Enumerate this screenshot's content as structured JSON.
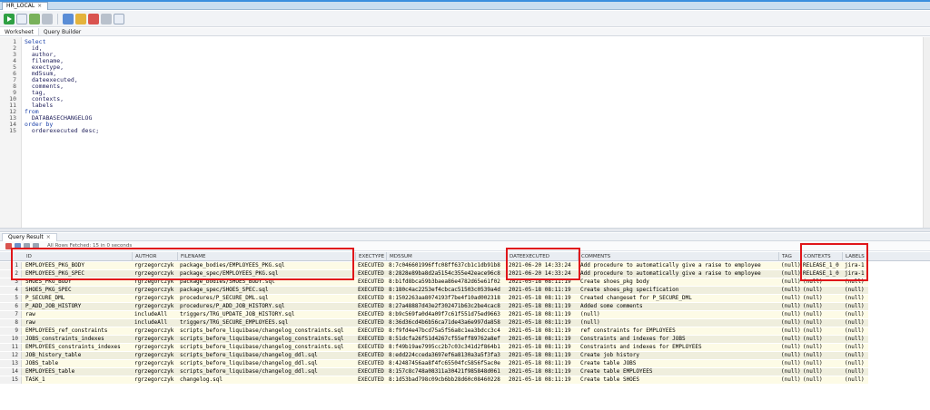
{
  "connection_tab": {
    "label": "HR_LOCAL"
  },
  "subtabs": [
    {
      "label": "Worksheet"
    },
    {
      "label": "Query Builder"
    }
  ],
  "editor": {
    "lines": [
      {
        "n": "1",
        "text": "Select"
      },
      {
        "n": "2",
        "text": "  id,"
      },
      {
        "n": "3",
        "text": "  author,"
      },
      {
        "n": "4",
        "text": "  filename,"
      },
      {
        "n": "5",
        "text": "  exectype,"
      },
      {
        "n": "6",
        "text": "  md5sum,"
      },
      {
        "n": "7",
        "text": "  dateexecuted,"
      },
      {
        "n": "8",
        "text": "  comments,"
      },
      {
        "n": "9",
        "text": "  tag,"
      },
      {
        "n": "10",
        "text": "  contexts,"
      },
      {
        "n": "11",
        "text": "  labels"
      },
      {
        "n": "12",
        "text": "from"
      },
      {
        "n": "13",
        "text": "  DATABASECHANGELOG"
      },
      {
        "n": "14",
        "text": "order by"
      },
      {
        "n": "15",
        "text": "  orderexecuted desc;"
      }
    ]
  },
  "results": {
    "tab_label": "Query Result",
    "fetch_info": "All Rows Fetched: 15 in 0 seconds",
    "columns": [
      "ID",
      "AUTHOR",
      "FILENAME",
      "EXECTYPE",
      "MD5SUM",
      "DATEEXECUTED",
      "COMMENTS",
      "TAG",
      "CONTEXTS",
      "LABELS"
    ],
    "rows": [
      [
        "1",
        "EMPLOYEES_PKG_BODY",
        "rgrzegorczyk",
        "package_bodies/EMPLOYEES_PKG.sql",
        "EXECUTED",
        "8:7c046601996ffc08ff637cb1c1db91b8",
        "2021-06-20 14:33:24",
        "Add procedure to automatically give a raise to employee",
        "(null)",
        "RELEASE_1_0",
        "jira-1"
      ],
      [
        "2",
        "EMPLOYEES_PKG_SPEC",
        "rgrzegorczyk",
        "package_spec/EMPLOYEES_PKG.sql",
        "EXECUTED",
        "8:2828e89ba8d2a5154c355e42eace96c8",
        "2021-06-20 14:33:24",
        "Add procedure to automatically give a raise to employee",
        "(null)",
        "RELEASE_1_0",
        "jira-1"
      ],
      [
        "3",
        "SHOES_PKG_BODY",
        "rgrzegorczyk",
        "package_bodies/SHOES_BODY.sql",
        "EXECUTED",
        "8:b1fd8bca59b3baea86e4782d65e61f02",
        "2021-05-18 08:11:19",
        "Create shoes_pkg body",
        "(null)",
        "(null)",
        "(null)"
      ],
      [
        "4",
        "SHOES_PKG_SPEC",
        "rgrzegorczyk",
        "package_spec/SHOES_SPEC.sql",
        "EXECUTED",
        "8:180c4ac2253ef4cbcac51503c0539a4d",
        "2021-05-18 08:11:19",
        "Create shoes_pkg specification",
        "(null)",
        "(null)",
        "(null)"
      ],
      [
        "5",
        "P_SECURE_DML",
        "rgrzegorczyk",
        "procedures/P_SECURE_DML.sql",
        "EXECUTED",
        "8:1502263aa8074193f7be4f10ad002318",
        "2021-05-18 08:11:19",
        "Created changeset for P_SECURE_DML",
        "(null)",
        "(null)",
        "(null)"
      ],
      [
        "6",
        "P_ADD_JOB_HISTORY",
        "rgrzegorczyk",
        "procedures/P_ADD_JOB_HISTORY.sql",
        "EXECUTED",
        "8:27a48887d43e2f302471b63c2be4cac8",
        "2021-05-18 08:11:19",
        "Added some comments",
        "(null)",
        "(null)",
        "(null)"
      ],
      [
        "7",
        "raw",
        "includeAll",
        "triggers/TRG_UPDATE_JOB_HISTORY.sql",
        "EXECUTED",
        "8:b9c569fa0d4a09f7c61f551d75ed9663",
        "2021-05-18 08:11:19",
        "(null)",
        "(null)",
        "(null)",
        "(null)"
      ],
      [
        "8",
        "raw",
        "includeAll",
        "triggers/TRG_SECURE_EMPLOYEES.sql",
        "EXECUTED",
        "8:36d36cd4b6b56ca71de43a6e997da858",
        "2021-05-18 08:11:19",
        "(null)",
        "(null)",
        "(null)",
        "(null)"
      ],
      [
        "9",
        "EMPLOYEES_ref_constraints",
        "rgrzegorczyk",
        "scripts_before_liquibase/changelog_constraints.sql",
        "EXECUTED",
        "8:f9fd4e47bcd75a5f56a8c1ea3bdcc3c4",
        "2021-05-18 08:11:19",
        "ref constraints  for EMPLOYEES",
        "(null)",
        "(null)",
        "(null)"
      ],
      [
        "10",
        "JOBS_constraints_indexes",
        "rgrzegorczyk",
        "scripts_before_liquibase/changelog_constraints.sql",
        "EXECUTED",
        "8:51dcfa26f51d4267cf55eff89762a8ef",
        "2021-05-18 08:11:19",
        "Constraints and indexes for JOBS",
        "(null)",
        "(null)",
        "(null)"
      ],
      [
        "11",
        "EMPLOYEES_constraints_indexes",
        "rgrzegorczyk",
        "scripts_before_liquibase/changelog_constraints.sql",
        "EXECUTED",
        "8:f49b19ae7995cc2b7c03c341d2f864b1",
        "2021-05-18 08:11:19",
        "Constraints and indexes  for EMPLOYEES",
        "(null)",
        "(null)",
        "(null)"
      ],
      [
        "12",
        "JOB_history_table",
        "rgrzegorczyk",
        "scripts_before_liquibase/changelog_ddl.sql",
        "EXECUTED",
        "8:edd224cceda3697ef6a8130a3a5f3fa3",
        "2021-05-18 08:11:19",
        "Create job history",
        "(null)",
        "(null)",
        "(null)"
      ],
      [
        "13",
        "JOBS_table",
        "rgrzegorczyk",
        "scripts_before_liquibase/changelog_ddl.sql",
        "EXECUTED",
        "8:42487456aa8f4fc65504fc5856f5ac0e",
        "2021-05-18 08:11:19",
        "Create table JOBS",
        "(null)",
        "(null)",
        "(null)"
      ],
      [
        "14",
        "EMPLOYEES_table",
        "rgrzegorczyk",
        "scripts_before_liquibase/changelog_ddl.sql",
        "EXECUTED",
        "8:157c8c748a08311a30421f985848d061",
        "2021-05-18 08:11:19",
        "Create table EMPLOYEES",
        "(null)",
        "(null)",
        "(null)"
      ],
      [
        "15",
        "TASK_1",
        "rgrzegorczyk",
        "changelog.sql",
        "EXECUTED",
        "8:1d53bad798c09cb6bb28d60c08460228",
        "2021-05-18 08:11:19",
        "Create table SHOES",
        "(null)",
        "(null)",
        "(null)"
      ]
    ]
  },
  "colors": {
    "highlight": "#e0161a",
    "row_odd": "#fdfbe6",
    "row_even": "#efeedd"
  }
}
